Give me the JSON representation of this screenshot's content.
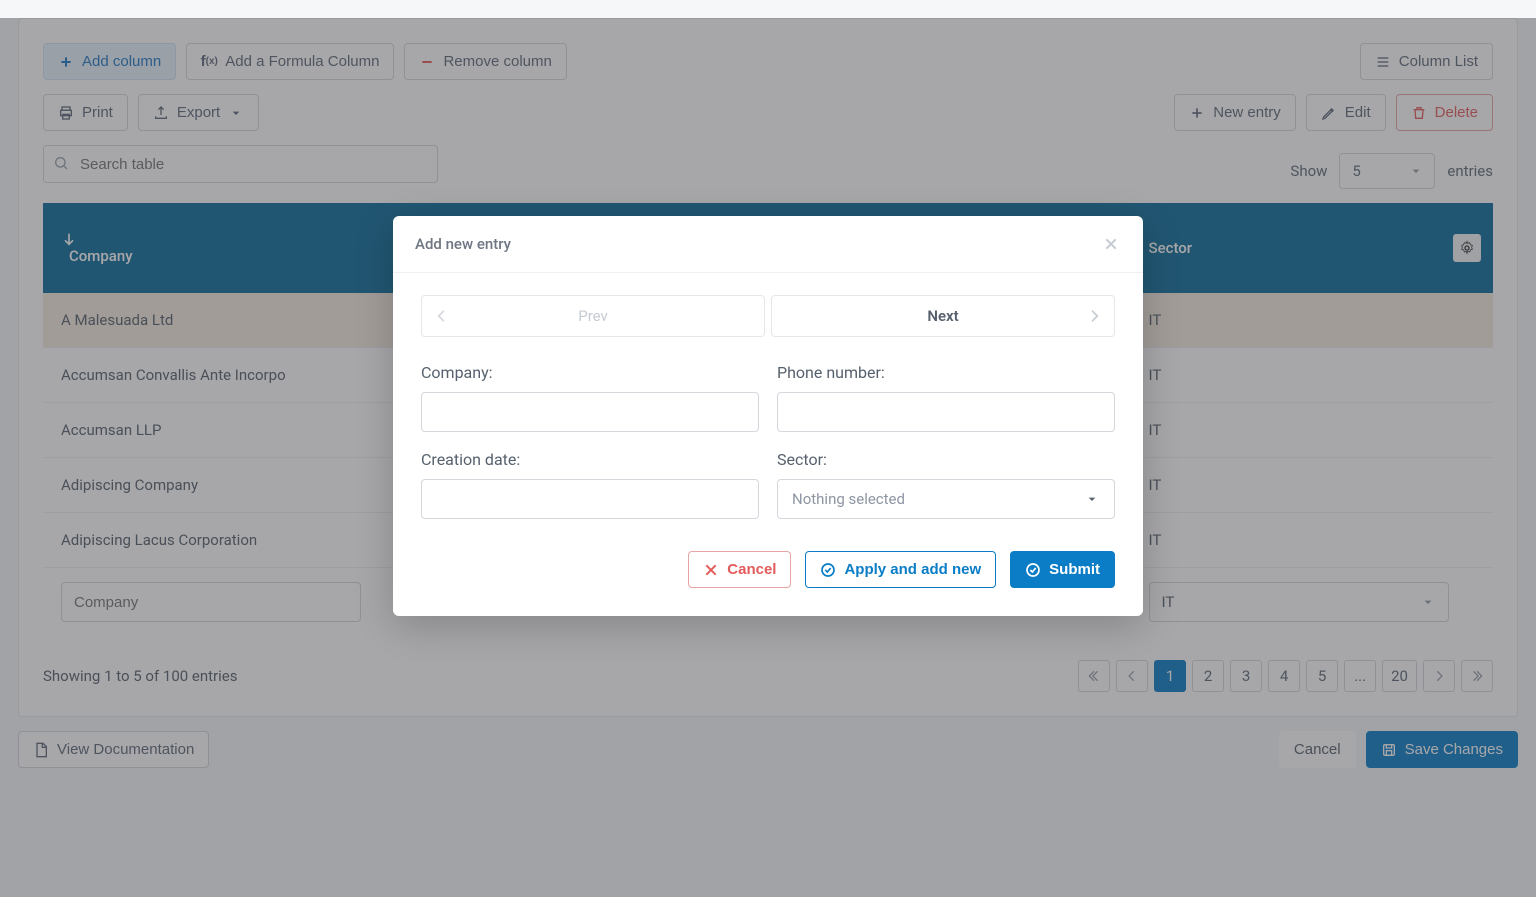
{
  "toolbar": {
    "add_column": "Add column",
    "add_formula": "Add a Formula Column",
    "remove_column": "Remove column",
    "column_list": "Column List",
    "print": "Print",
    "export": "Export",
    "new_entry": "New entry",
    "edit": "Edit",
    "delete": "Delete"
  },
  "search": {
    "placeholder": "Search table"
  },
  "length": {
    "show": "Show",
    "value": "5",
    "entries": "entries"
  },
  "columns": {
    "company": "Company",
    "sector": "Sector"
  },
  "rows": [
    {
      "company": "A Malesuada Ltd",
      "sector": "IT"
    },
    {
      "company": "Accumsan Convallis Ante Incorpo",
      "sector": "IT"
    },
    {
      "company": "Accumsan LLP",
      "sector": "IT"
    },
    {
      "company": "Adipiscing Company",
      "sector": "IT"
    },
    {
      "company": "Adipiscing Lacus Corporation",
      "sector": "IT"
    }
  ],
  "filters": {
    "company_placeholder": "Company",
    "sector_value": "IT"
  },
  "info": "Showing 1 to 5 of 100 entries",
  "pagination": {
    "pages": [
      "1",
      "2",
      "3",
      "4",
      "5",
      "...",
      "20"
    ],
    "active": "1"
  },
  "bottom": {
    "view_docs": "View Documentation",
    "cancel": "Cancel",
    "save": "Save Changes"
  },
  "modal": {
    "title": "Add new entry",
    "prev": "Prev",
    "next": "Next",
    "company_label": "Company:",
    "phone_label": "Phone number:",
    "date_label": "Creation date:",
    "sector_label": "Sector:",
    "sector_placeholder": "Nothing selected",
    "cancel": "Cancel",
    "apply_add": "Apply and add new",
    "submit": "Submit"
  }
}
